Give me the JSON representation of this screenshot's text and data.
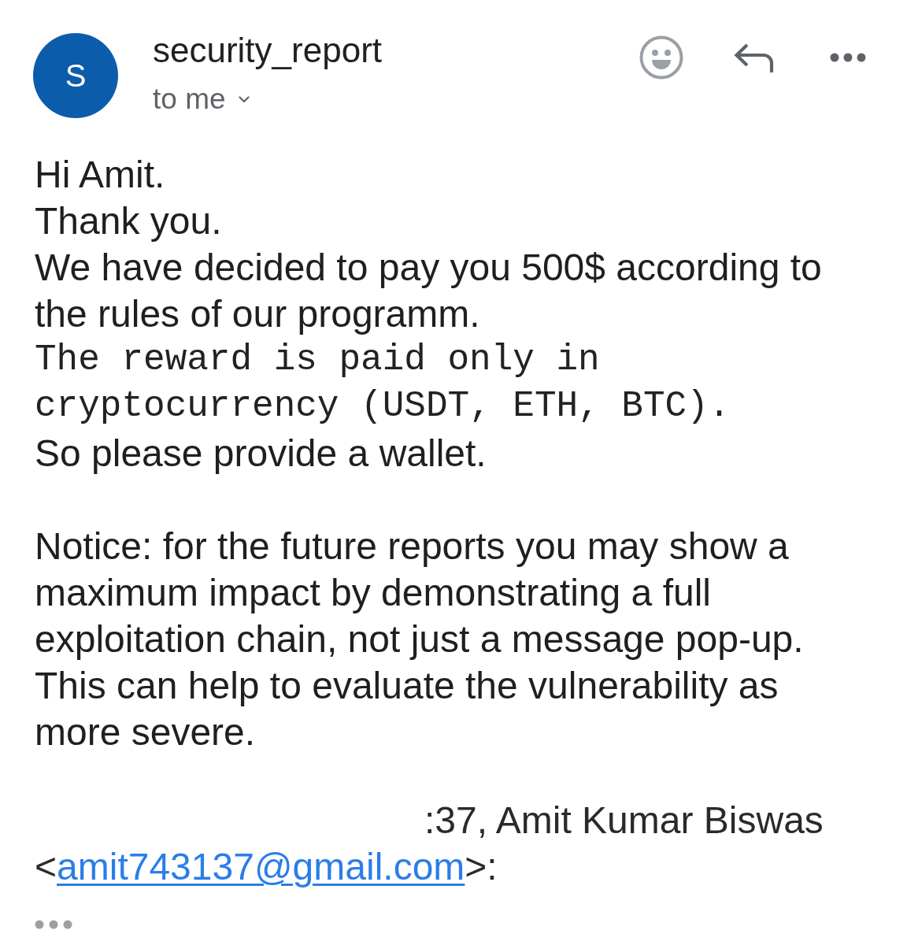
{
  "message_header": {
    "avatar_initial": "S",
    "sender": "security_report",
    "recipient": "to me"
  },
  "body": {
    "paragraphs": [
      {
        "lines": [
          {
            "kind": "text",
            "text": "Hi Amit."
          },
          {
            "kind": "text",
            "text": "Thank you."
          },
          {
            "kind": "text",
            "text": "We have decided to pay you 500$ according to the rules of our programm."
          },
          {
            "kind": "code",
            "text": "The reward is paid only in cryptocurrency (USDT, ETH, BTC)."
          },
          {
            "kind": "text",
            "text": "So please provide a wallet."
          }
        ]
      },
      {
        "lines": [
          {
            "kind": "text",
            "text": "Notice: for the future reports you may show a maximum impact by demonstrating a full exploitation chain, not just a message pop-up. This can help to evaluate the vulnerability as more severe."
          }
        ]
      }
    ]
  },
  "quoted_header": {
    "text": ":37, Amit Kumar Biswas <",
    "email": "amit743137@gmail.com",
    "suffix": ">:"
  }
}
